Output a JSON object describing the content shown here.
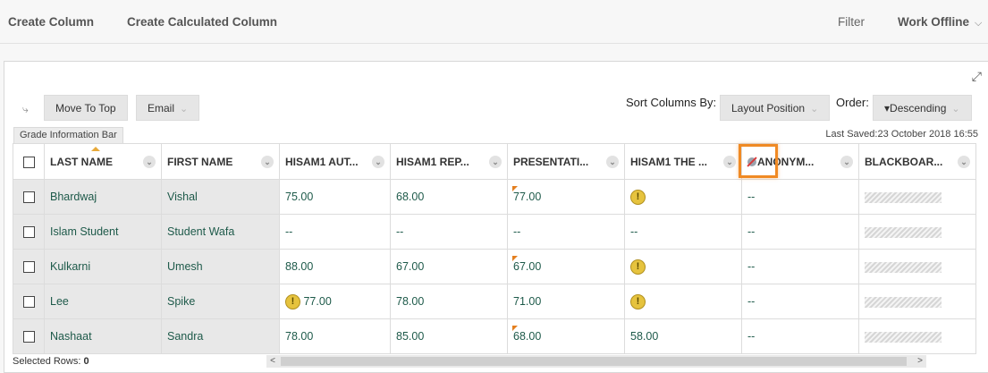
{
  "toolbar": {
    "create_column": "Create Column",
    "create_calculated_column": "Create Calculated Column",
    "filter": "Filter",
    "work_offline": "Work Offline"
  },
  "actions": {
    "move_to_top": "Move To Top",
    "email": "Email",
    "sort_label": "Sort Columns By:",
    "sort_value": "Layout Position",
    "order_label": "Order:",
    "order_value": "▾Descending"
  },
  "info_bar": {
    "label": "Grade Information Bar",
    "last_saved": "Last Saved:23 October 2018 16:55"
  },
  "columns": [
    "LAST NAME",
    "FIRST NAME",
    "HISAM1 AUT...",
    "HISAM1 REP...",
    "PRESENTATI...",
    "HISAM1 THE ...",
    "ANONYM...",
    "BLACKBOAR..."
  ],
  "rows": [
    {
      "last": "Bhardwaj",
      "first": "Vishal",
      "aut": "75.00",
      "rep": "68.00",
      "pres": "77.00",
      "the": "",
      "anon": "--"
    },
    {
      "last": "Islam Student",
      "first": "Student Wafa",
      "aut": "--",
      "rep": "--",
      "pres": "--",
      "the": "--",
      "anon": "--"
    },
    {
      "last": "Kulkarni",
      "first": "Umesh",
      "aut": "88.00",
      "rep": "67.00",
      "pres": "67.00",
      "the": "",
      "anon": "--"
    },
    {
      "last": "Lee",
      "first": "Spike",
      "aut": "77.00",
      "rep": "78.00",
      "pres": "71.00",
      "the": "",
      "anon": "--"
    },
    {
      "last": "Nashaat",
      "first": "Sandra",
      "aut": "78.00",
      "rep": "85.00",
      "pres": "68.00",
      "the": "58.00",
      "anon": "--"
    }
  ],
  "footer": {
    "selected_label": "Selected Rows:",
    "selected_count": "0"
  },
  "icons": {
    "warning": "needs-grading-icon",
    "flag": "override-flag-icon",
    "anonymous": "anonymous-grading-icon"
  },
  "colors": {
    "accent": "#f08a24",
    "link": "#1e5a4a",
    "gray_cell": "#e8e8e8"
  }
}
